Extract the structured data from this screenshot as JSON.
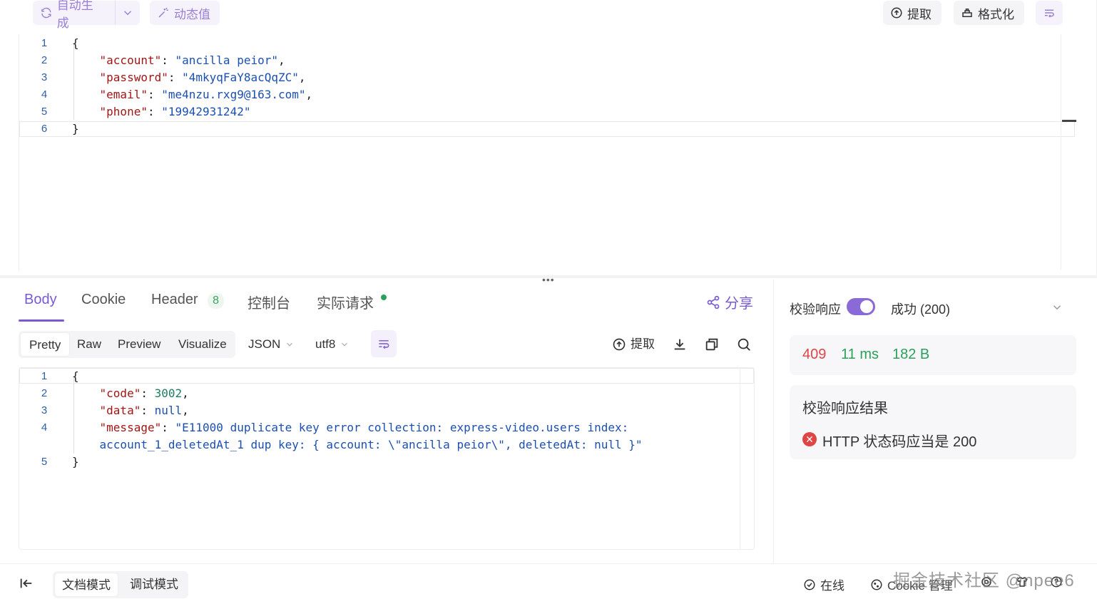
{
  "toolbar": {
    "auto_generate_label": "自动生成",
    "dynamic_value_label": "动态值",
    "extract_label": "提取",
    "format_label": "格式化"
  },
  "request_body": {
    "lines": [
      {
        "num": "1",
        "tokens": [
          {
            "t": "{",
            "c": "pun"
          }
        ]
      },
      {
        "num": "2",
        "tokens": [
          {
            "t": "    \"account\"",
            "c": "key"
          },
          {
            "t": ": ",
            "c": "pun"
          },
          {
            "t": "\"ancilla peior\"",
            "c": "str"
          },
          {
            "t": ",",
            "c": "pun"
          }
        ]
      },
      {
        "num": "3",
        "tokens": [
          {
            "t": "    \"password\"",
            "c": "key"
          },
          {
            "t": ": ",
            "c": "pun"
          },
          {
            "t": "\"4mkyqFaY8acQqZC\"",
            "c": "str"
          },
          {
            "t": ",",
            "c": "pun"
          }
        ]
      },
      {
        "num": "4",
        "tokens": [
          {
            "t": "    \"email\"",
            "c": "key"
          },
          {
            "t": ": ",
            "c": "pun"
          },
          {
            "t": "\"me4nzu.rxg9@163.com\"",
            "c": "str"
          },
          {
            "t": ",",
            "c": "pun"
          }
        ]
      },
      {
        "num": "5",
        "tokens": [
          {
            "t": "    \"phone\"",
            "c": "key"
          },
          {
            "t": ": ",
            "c": "pun"
          },
          {
            "t": "\"19942931242\"",
            "c": "str"
          }
        ]
      },
      {
        "num": "6",
        "tokens": [
          {
            "t": "}",
            "c": "pun"
          }
        ]
      }
    ]
  },
  "response_tabs": {
    "body": "Body",
    "cookie": "Cookie",
    "header": "Header",
    "header_count": "8",
    "console": "控制台",
    "actual_request": "实际请求",
    "share": "分享"
  },
  "view_modes": {
    "pretty": "Pretty",
    "raw": "Raw",
    "preview": "Preview",
    "visualize": "Visualize",
    "format": "JSON",
    "encoding": "utf8",
    "extract": "提取"
  },
  "response_body": {
    "lines": [
      {
        "num": "1",
        "tokens": [
          {
            "t": "{",
            "c": "pun"
          }
        ]
      },
      {
        "num": "2",
        "tokens": [
          {
            "t": "    \"code\"",
            "c": "key"
          },
          {
            "t": ": ",
            "c": "pun"
          },
          {
            "t": "3002",
            "c": "num"
          },
          {
            "t": ",",
            "c": "pun"
          }
        ]
      },
      {
        "num": "3",
        "tokens": [
          {
            "t": "    \"data\"",
            "c": "key"
          },
          {
            "t": ": ",
            "c": "pun"
          },
          {
            "t": "null",
            "c": "null"
          },
          {
            "t": ",",
            "c": "pun"
          }
        ]
      },
      {
        "num": "4",
        "tokens": [
          {
            "t": "    \"message\"",
            "c": "key"
          },
          {
            "t": ": ",
            "c": "pun"
          },
          {
            "t": "\"E11000 duplicate key error collection: express-video.users index:",
            "c": "str"
          }
        ]
      },
      {
        "num": "",
        "tokens": [
          {
            "t": "    account_1_deletedAt_1 dup key: { account: \\\"ancilla peior\\\", deletedAt: null }\"",
            "c": "str"
          }
        ]
      },
      {
        "num": "5",
        "tokens": [
          {
            "t": "}",
            "c": "pun"
          }
        ]
      }
    ]
  },
  "validation": {
    "label": "校验响应",
    "status_option": "成功 (200)",
    "status_code": "409",
    "time": "11 ms",
    "size": "182 B",
    "result_title": "校验响应结果",
    "result_message": "HTTP 状态码应当是 200"
  },
  "bottom_bar": {
    "doc_mode": "文档模式",
    "debug_mode": "调试模式",
    "online": "在线",
    "cookie_manage": "Cookie 管理",
    "watermark": "掘金技术社区 @npee6"
  },
  "colors": {
    "accent": "#7a5ad0",
    "error": "#e04545",
    "success": "#2aa15a"
  }
}
